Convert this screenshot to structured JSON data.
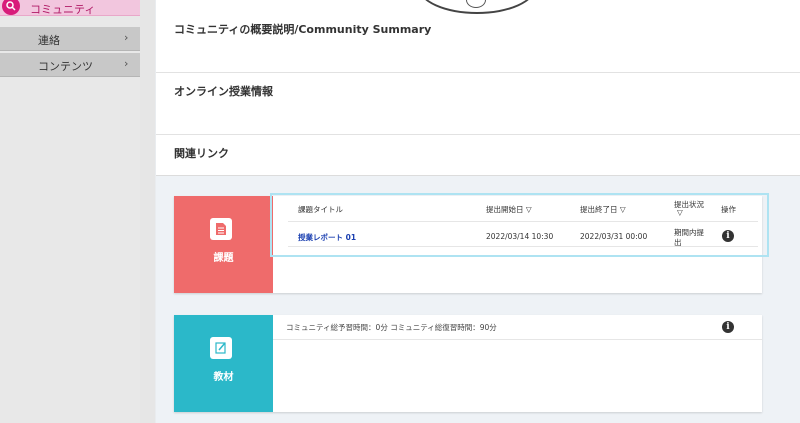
{
  "sidebar": {
    "active_item": "コミュニティ",
    "items": [
      {
        "label": "連絡",
        "chevron": "›"
      },
      {
        "label": "コンテンツ",
        "chevron": "›"
      }
    ]
  },
  "summary": {
    "community_summary_title": "コミュニティの概要説明/Community Summary",
    "online_class_title": "オンライン授業情報",
    "related_links_title": "関連リンク"
  },
  "assignments": {
    "label": "課題",
    "accent": "#ef6b6b",
    "icon": "document-icon",
    "columns": {
      "title": "課題タイトル",
      "start": "提出開始日 ▽",
      "end": "提出終了日 ▽",
      "status": "提出状況",
      "status_sort": "▽",
      "action": "操作"
    },
    "rows": [
      {
        "title": "授業レポート 01",
        "start": "2022/03/14 10:30",
        "end": "2022/03/31 00:00",
        "status_line1": "期間内提",
        "status_line2": "出",
        "action_icon": "info-icon"
      }
    ]
  },
  "materials": {
    "label": "教材",
    "accent": "#2bb8c9",
    "icon": "edit-icon",
    "summary": "コミュニティ総予習時間：0分 コミュニティ総復習時間：90分",
    "action_icon": "info-icon"
  }
}
